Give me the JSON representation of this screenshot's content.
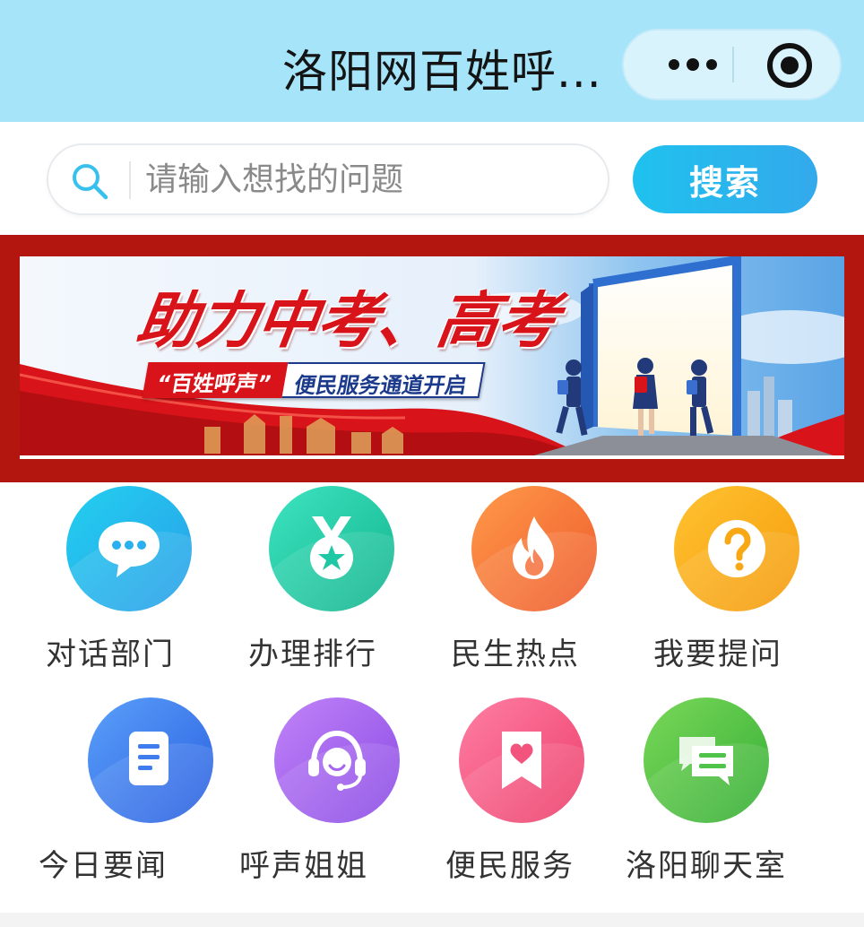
{
  "header": {
    "title": "洛阳网百姓呼...",
    "background": "#a6e4fa"
  },
  "search": {
    "placeholder": "请输入想找的问题",
    "button_label": "搜索",
    "accent": "#23b8ee"
  },
  "banner": {
    "headline": "助力中考、高考",
    "tag_left": "“百姓呼声”",
    "tag_right": "便民服务通道开启",
    "frame_color": "#b3150f"
  },
  "grid": {
    "row1": [
      {
        "label": "对话部门",
        "icon": "chat-bubble-icon",
        "color": "#2ab0ee"
      },
      {
        "label": "办理排行",
        "icon": "medal-icon",
        "color": "#1fc8a4"
      },
      {
        "label": "民生热点",
        "icon": "flame-icon",
        "color": "#f3743a"
      },
      {
        "label": "我要提问",
        "icon": "question-icon",
        "color": "#f8a815"
      }
    ],
    "row2": [
      {
        "label": "今日要闻",
        "icon": "document-icon",
        "color": "#3f7def"
      },
      {
        "label": "呼声姐姐",
        "icon": "headset-icon",
        "color": "#a566ec"
      },
      {
        "label": "便民服务",
        "icon": "heart-bookmark-icon",
        "color": "#f2547e"
      },
      {
        "label": "洛阳聊天室",
        "icon": "chat-lines-icon",
        "color": "#4fc34a"
      }
    ]
  }
}
